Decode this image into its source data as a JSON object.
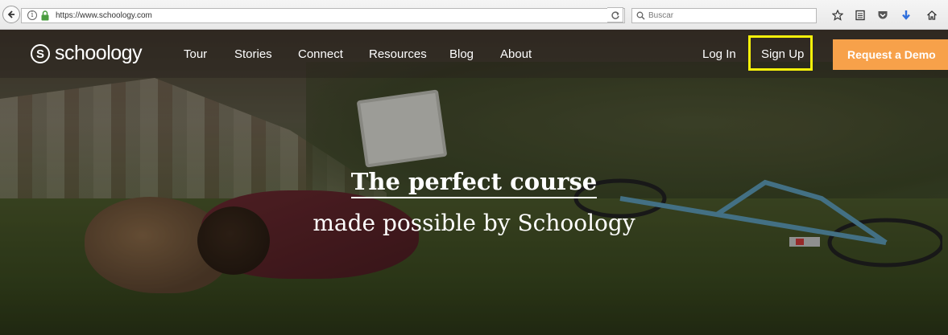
{
  "browser": {
    "url": "https://www.schoology.com",
    "search_placeholder": "Buscar",
    "icons": [
      "back-icon",
      "info-icon",
      "lock-icon",
      "reload-icon",
      "search-icon",
      "bookmark-star-icon",
      "reading-list-icon",
      "pocket-icon",
      "download-icon",
      "home-icon"
    ]
  },
  "nav": {
    "logo_mark": "S",
    "logo_text": "schoology",
    "links": [
      "Tour",
      "Stories",
      "Connect",
      "Resources",
      "Blog",
      "About"
    ],
    "login": "Log In",
    "signup": "Sign Up",
    "demo": "Request a Demo",
    "colors": {
      "demo_button": "#f7a14a",
      "signup_highlight": "#f7f20a"
    }
  },
  "hero": {
    "headline": "The perfect course",
    "subhead": "made possible by Schoology"
  }
}
